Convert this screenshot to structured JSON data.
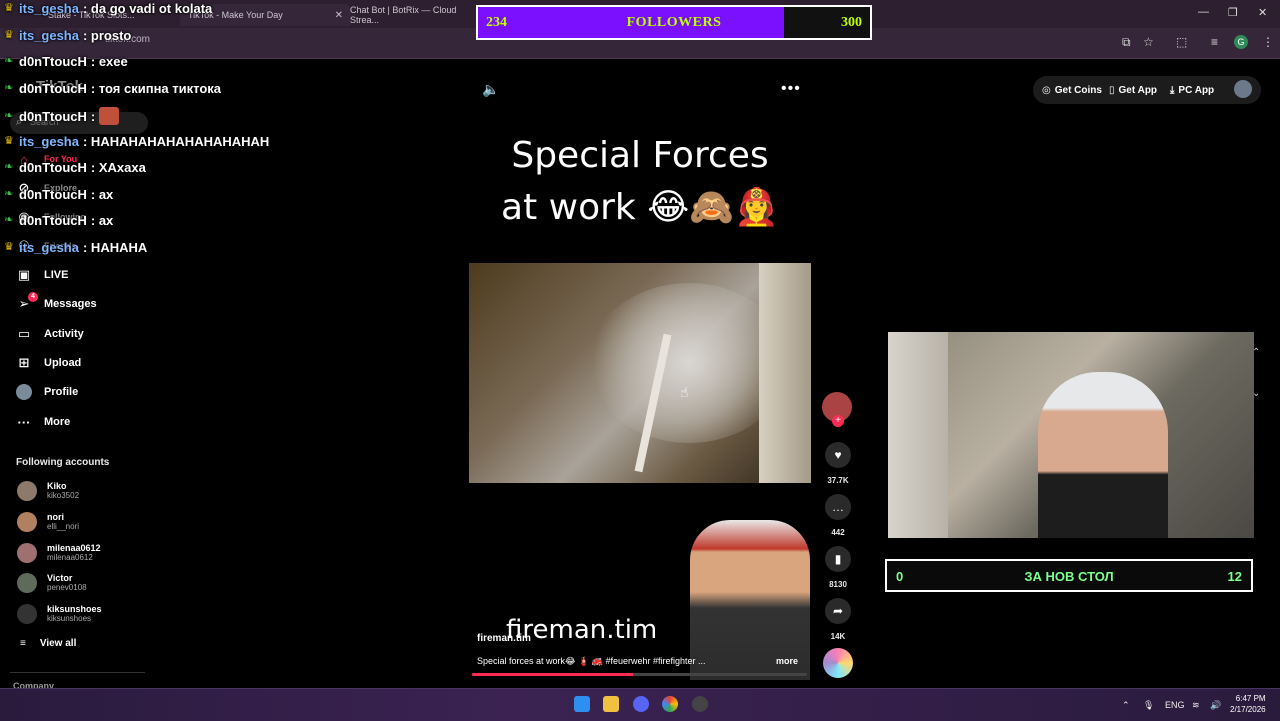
{
  "browser": {
    "tabs": [
      {
        "label": "Stake - TikTok Slots...",
        "active": false
      },
      {
        "label": "TikTok - Make Your Day",
        "active": true
      },
      {
        "label": "Chat Bot | BotRix — Cloud Strea...",
        "active": false
      }
    ],
    "new_tab_symbol": "+",
    "url": "tiktok.com",
    "profile_letter": "G",
    "window_controls": [
      "—",
      "❐",
      "✕"
    ]
  },
  "followers_goal": {
    "current": "234",
    "label": "FOLLOWERS",
    "target": "300",
    "progress_fraction": 0.78
  },
  "tiktok": {
    "logo_text": "TikTok",
    "search_placeholder": "Search",
    "nav": [
      {
        "label": "For You",
        "icon": "home-icon"
      },
      {
        "label": "Explore",
        "icon": "compass-icon"
      },
      {
        "label": "Following",
        "icon": "following-icon"
      },
      {
        "label": "Friends",
        "icon": "friends-icon"
      },
      {
        "label": "LIVE",
        "icon": "live-icon"
      },
      {
        "label": "Messages",
        "icon": "messages-icon",
        "badge": "4"
      },
      {
        "label": "Activity",
        "icon": "activity-icon"
      },
      {
        "label": "Upload",
        "icon": "upload-icon"
      },
      {
        "label": "Profile",
        "icon": "profile-icon"
      },
      {
        "label": "More",
        "icon": "more-icon"
      }
    ],
    "following_title": "Following accounts",
    "following_accounts": [
      {
        "name": "Kiko",
        "handle": "kiko3502"
      },
      {
        "name": "nori",
        "handle": "elli__nori"
      },
      {
        "name": "milenaa0612",
        "handle": "milenaa0612"
      },
      {
        "name": "Victor",
        "handle": "penev0108"
      },
      {
        "name": "kiksunshoes",
        "handle": "kiksunshoes"
      }
    ],
    "view_all": "View all",
    "company": "Company",
    "top_actions": {
      "get_coins": "Get Coins",
      "get_app": "Get App",
      "pc_app": "PC App"
    },
    "video": {
      "caption_line1": "Special Forces",
      "caption_line2": "at work 😂🙈👩‍🚒",
      "overlay_name": "fireman.tim",
      "author": "fireman.tim",
      "description": "Special forces at work😂 🧯 🚒 #feuerwehr #firefighter ...",
      "more": "more",
      "progress_fraction": 0.48
    },
    "actions": {
      "likes": "37.7K",
      "comments": "442",
      "saves": "8130",
      "shares": "14K"
    }
  },
  "chat": [
    {
      "user": "its_gesha",
      "text": ": da go vadi ot kolata",
      "badge": "crown"
    },
    {
      "user": "its_gesha",
      "text": ": prosto",
      "badge": "crown"
    },
    {
      "user": "d0nTtoucH",
      "text": ": exee",
      "badge": "leaf"
    },
    {
      "user": "d0nTtoucH",
      "text": ": тоя скипна тиктока",
      "badge": "leaf"
    },
    {
      "user": "d0nTtoucH",
      "text": ":",
      "badge": "leaf",
      "emote": true
    },
    {
      "user": "its_gesha",
      "text": ": НАНАНАНАНАНАНАНАНАН",
      "badge": "crown"
    },
    {
      "user": "d0nTtoucH",
      "text": ": ХАхаха",
      "badge": "leaf"
    },
    {
      "user": "d0nTtoucH",
      "text": ": ax",
      "badge": "leaf"
    },
    {
      "user": "d0nTtoucH",
      "text": ": ax",
      "badge": "leaf"
    },
    {
      "user": "its_gesha",
      "text": ": НАНАНА",
      "badge": "crown"
    }
  ],
  "second_goal": {
    "current": "0",
    "label": "ЗА НОВ СТОЛ",
    "target": "12"
  },
  "taskbar": {
    "language": "ENG",
    "time": "6:47 PM",
    "date": "2/17/2026"
  }
}
